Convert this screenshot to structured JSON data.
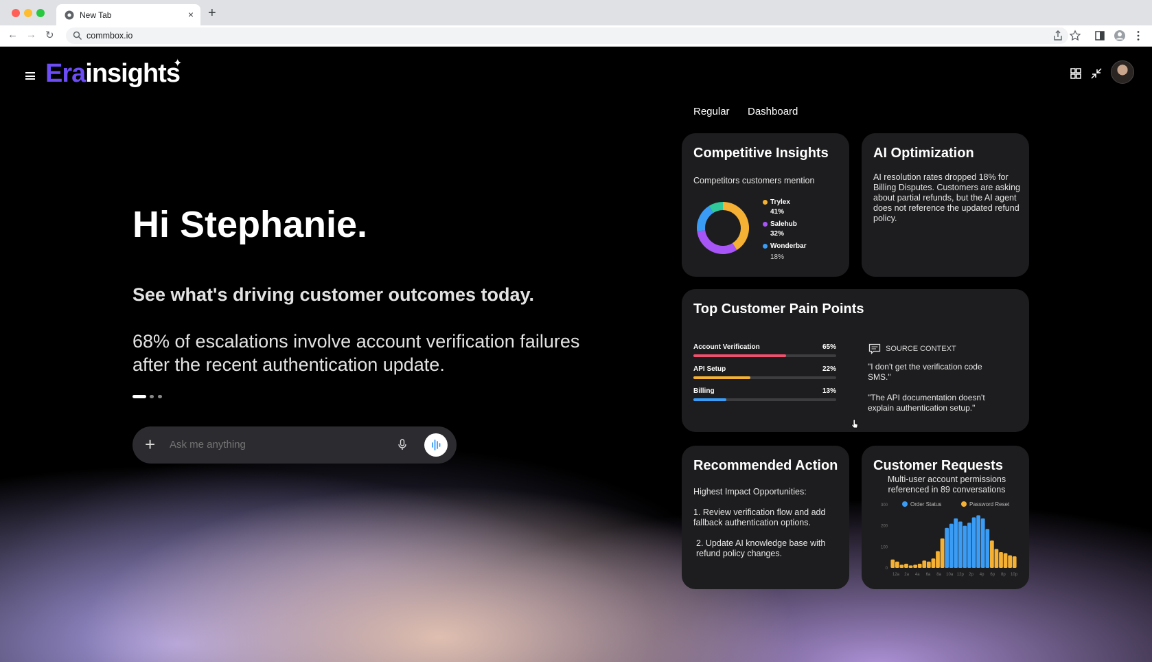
{
  "browser": {
    "tab_title": "New Tab",
    "tab_close": "×",
    "new_tab": "+",
    "url": "commbox.io",
    "back": "←",
    "forward": "→",
    "reload": "↻"
  },
  "app": {
    "logo_era": "Era",
    "logo_insights": "insights",
    "logo_spark": "✦"
  },
  "mode_tabs": [
    "Regular",
    "Dashboard"
  ],
  "hero": {
    "greeting": "Hi Stephanie.",
    "subtitle": "See what's driving customer outcomes today.",
    "insight": "68% of escalations involve account verification failures after the recent authentication update."
  },
  "ask": {
    "placeholder": "Ask me anything",
    "plus": "+"
  },
  "competitive": {
    "title": "Competitive Insights",
    "subtitle": "Competitors customers mention",
    "legend": [
      {
        "name": "Trylex",
        "value": "41%",
        "color": "#f5b133"
      },
      {
        "name": "Salehub",
        "value": "32%",
        "color": "#a855f7"
      },
      {
        "name": "Wonderbar",
        "value": "18%",
        "color": "#3b9cf5"
      }
    ]
  },
  "ai_opt": {
    "title": "AI Optimization",
    "text": "AI resolution rates dropped 18% for Billing Disputes. Customers are asking about partial refunds, but the AI agent does not reference the updated refund policy."
  },
  "pain_points": {
    "title": "Top Customer Pain Points",
    "items": [
      {
        "label": "Account Verification",
        "value": "65%",
        "pct": 65,
        "color": "#f0506e"
      },
      {
        "label": "API Setup",
        "value": "22%",
        "pct": 40,
        "color": "#f5b133"
      },
      {
        "label": "Billing",
        "value": "13%",
        "pct": 23,
        "color": "#3b9cf5"
      }
    ],
    "source_header": "SOURCE CONTEXT",
    "quote1": "\"I don't get the verification code SMS.\"",
    "quote2": "\"The API documentation doesn't explain authentication setup.\""
  },
  "recommended": {
    "title": "Recommended Action",
    "heading": "Highest Impact Opportunities:",
    "item1": "1. Review verification flow and add fallback authentication options.",
    "item2": "2. Update AI knowledge base with refund policy changes."
  },
  "requests": {
    "title": "Customer Requests",
    "subtitle": "Multi-user account permissions referenced in 89 conversations",
    "legend": [
      {
        "name": "Order Status",
        "color": "#3b9cf5"
      },
      {
        "name": "Password Reset",
        "color": "#f5b133"
      }
    ]
  },
  "chart_data": {
    "type": "bar",
    "ylim": [
      0,
      300
    ],
    "yticks": [
      "300",
      "200",
      "100",
      "0"
    ],
    "xticks": [
      "12a",
      "2a",
      "4a",
      "6a",
      "8a",
      "10a",
      "12p",
      "2p",
      "4p",
      "6p",
      "8p",
      "10p"
    ],
    "series": [
      {
        "name": "Order Status",
        "color": "#3b9cf5"
      },
      {
        "name": "Password Reset",
        "color": "#f5b133"
      }
    ],
    "bars": [
      {
        "v": 40,
        "s": 1
      },
      {
        "v": 30,
        "s": 1
      },
      {
        "v": 15,
        "s": 1
      },
      {
        "v": 20,
        "s": 1
      },
      {
        "v": 12,
        "s": 1
      },
      {
        "v": 15,
        "s": 1
      },
      {
        "v": 20,
        "s": 1
      },
      {
        "v": 35,
        "s": 1
      },
      {
        "v": 30,
        "s": 1
      },
      {
        "v": 45,
        "s": 1
      },
      {
        "v": 80,
        "s": 1
      },
      {
        "v": 140,
        "s": 1
      },
      {
        "v": 190,
        "s": 0
      },
      {
        "v": 210,
        "s": 0
      },
      {
        "v": 235,
        "s": 0
      },
      {
        "v": 220,
        "s": 0
      },
      {
        "v": 200,
        "s": 0
      },
      {
        "v": 215,
        "s": 0
      },
      {
        "v": 240,
        "s": 0
      },
      {
        "v": 250,
        "s": 0
      },
      {
        "v": 235,
        "s": 0
      },
      {
        "v": 185,
        "s": 0
      },
      {
        "v": 130,
        "s": 1
      },
      {
        "v": 90,
        "s": 1
      },
      {
        "v": 75,
        "s": 1
      },
      {
        "v": 70,
        "s": 1
      },
      {
        "v": 60,
        "s": 1
      },
      {
        "v": 55,
        "s": 1
      }
    ]
  }
}
